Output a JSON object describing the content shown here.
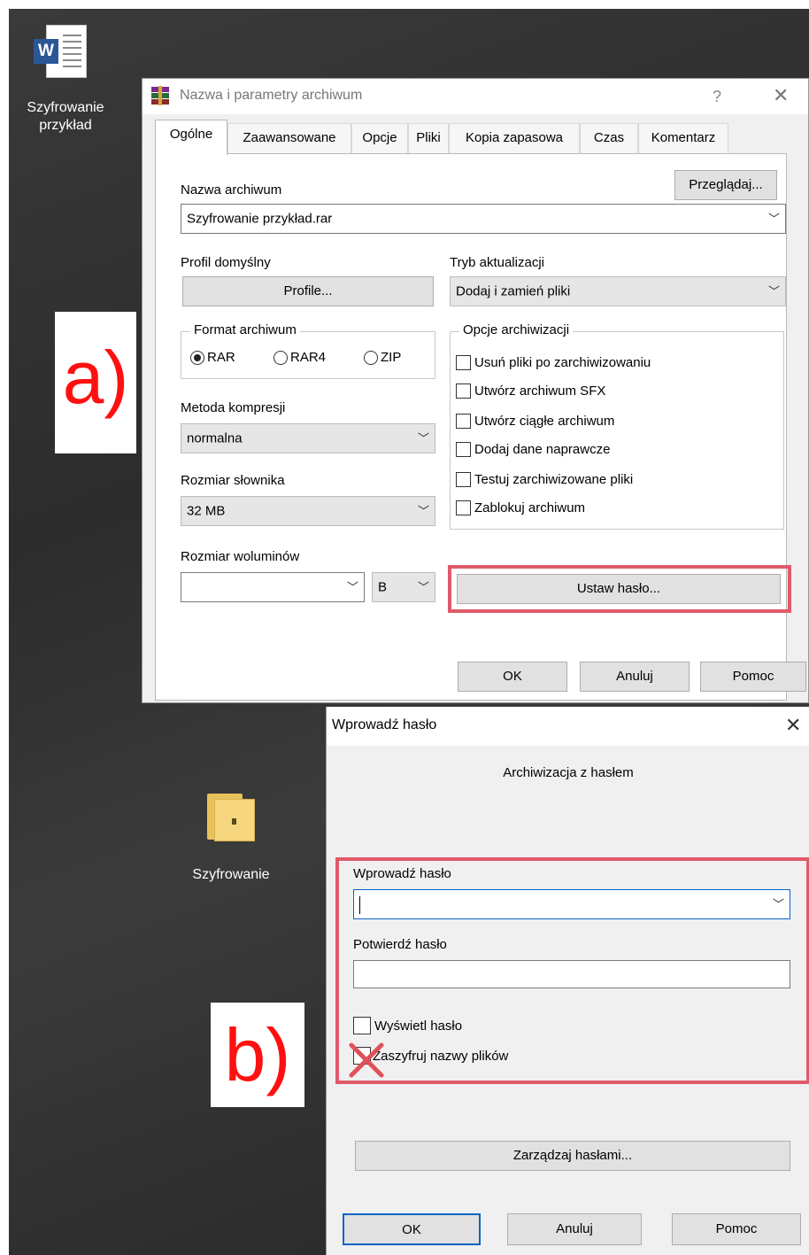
{
  "desktop": {
    "icons": [
      {
        "label_line1": "Szyfrowanie",
        "label_line2": "przykład",
        "icon": "word-document-icon"
      },
      {
        "label": "Szyfrowanie",
        "icon": "folder-icon"
      }
    ]
  },
  "dialog_a": {
    "title": "Nazwa i parametry archiwum",
    "help": "?",
    "close": "✕",
    "tabs": [
      "Ogólne",
      "Zaawansowane",
      "Opcje",
      "Pliki",
      "Kopia zapasowa",
      "Czas",
      "Komentarz"
    ],
    "browse_label": "Przeglądaj...",
    "archive_name_label": "Nazwa archiwum",
    "archive_name_value": "Szyfrowanie przykład.rar",
    "profile_label": "Profil domyślny",
    "profiles_button": "Profile...",
    "update_mode_label": "Tryb aktualizacji",
    "update_mode_value": "Dodaj i zamień pliki",
    "format_group_title": "Format archiwum",
    "formats": [
      "RAR",
      "RAR4",
      "ZIP"
    ],
    "format_selected": "RAR",
    "options_group_title": "Opcje archiwizacji",
    "options": [
      "Usuń pliki po zarchiwizowaniu",
      "Utwórz archiwum SFX",
      "Utwórz ciągłe archiwum",
      "Dodaj dane naprawcze",
      "Testuj zarchiwizowane pliki",
      "Zablokuj archiwum"
    ],
    "compression_label": "Metoda kompresji",
    "compression_value": "normalna",
    "dictionary_label": "Rozmiar słownika",
    "dictionary_value": "32 MB",
    "volume_label": "Rozmiar woluminów",
    "volume_value": "",
    "volume_unit": "B",
    "set_password_button": "Ustaw hasło...",
    "ok": "OK",
    "cancel": "Anuluj",
    "help_button": "Pomoc",
    "marker": "a)"
  },
  "dialog_b": {
    "title": "Wprowadź hasło",
    "close": "✕",
    "heading": "Archiwizacja z hasłem",
    "enter_password_label": "Wprowadź hasło",
    "enter_password_value": "",
    "confirm_password_label": "Potwierdź hasło",
    "confirm_password_value": "",
    "show_password_label": "Wyświetl hasło",
    "encrypt_names_label": "Zaszyfruj nazwy plików",
    "manage_passwords_button": "Zarządzaj hasłami...",
    "ok": "OK",
    "cancel": "Anuluj",
    "help_button": "Pomoc",
    "marker": "b)"
  },
  "colors": {
    "highlight_box": "#e05a6a",
    "marker_text": "#ff1010",
    "cross_mark": "#e0505a",
    "focus_border": "#0a64c8"
  }
}
